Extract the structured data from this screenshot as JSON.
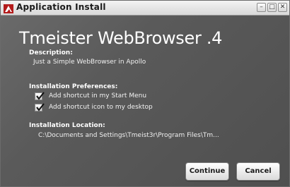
{
  "window": {
    "title": "Application Install",
    "controls": {
      "minimize": "–",
      "maximize": "□",
      "close": "✕"
    }
  },
  "app": {
    "name": "Tmeister WebBrowser .4"
  },
  "description": {
    "label": "Description:",
    "text": "Just a Simple WebBrowser in Apollo"
  },
  "preferences": {
    "label": "Installation Preferences:",
    "items": [
      {
        "label": "Add shortcut in my Start Menu",
        "checked": true
      },
      {
        "label": "Add shortcut icon to my desktop",
        "checked": true
      }
    ]
  },
  "location": {
    "label": "Installation Location:",
    "path": "C:\\Documents and Settings\\Tmeist3r\\Program Files\\Tm..."
  },
  "buttons": {
    "continue": "Continue",
    "cancel": "Cancel"
  },
  "colors": {
    "background": "#5a5a5a",
    "text": "#ffffff",
    "titlebar": "#e6e6e6"
  }
}
